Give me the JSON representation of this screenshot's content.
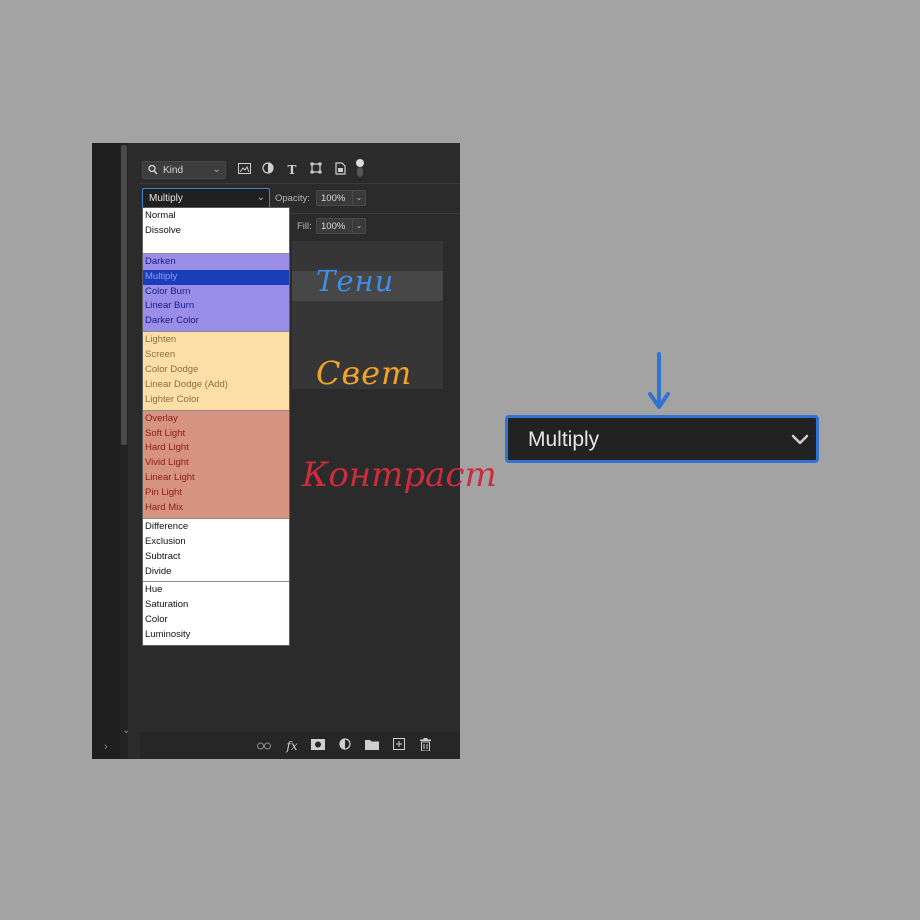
{
  "filter_bar": {
    "kind_label": "Kind",
    "icons": [
      "search-icon",
      "image-filter-icon",
      "adjustment-filter-icon",
      "type-filter-icon",
      "shape-filter-icon",
      "smart-object-filter-icon",
      "filter-toggle-icon"
    ]
  },
  "blend_mode": {
    "current": "Multiply",
    "opacity_label": "Opacity:",
    "opacity_value": "100%",
    "fill_label": "Fill:",
    "fill_value": "100%"
  },
  "dropdown_groups": [
    {
      "id": "basic",
      "items": [
        "Normal",
        "Dissolve"
      ]
    },
    {
      "id": "darken",
      "items": [
        "Darken",
        "Multiply",
        "Color Burn",
        "Linear Burn",
        "Darker Color"
      ],
      "selected": "Multiply"
    },
    {
      "id": "lighten",
      "items": [
        "Lighten",
        "Screen",
        "Color Dodge",
        "Linear Dodge (Add)",
        "Lighter Color"
      ]
    },
    {
      "id": "contrast",
      "items": [
        "Overlay",
        "Soft Light",
        "Hard Light",
        "Vivid Light",
        "Linear Light",
        "Pin Light",
        "Hard Mix"
      ]
    },
    {
      "id": "inversion",
      "items": [
        "Difference",
        "Exclusion",
        "Subtract",
        "Divide"
      ]
    },
    {
      "id": "component",
      "items": [
        "Hue",
        "Saturation",
        "Color",
        "Luminosity"
      ]
    }
  ],
  "annotations": {
    "shadows": "Тени",
    "light": "Свет",
    "contrast": "Контраст"
  },
  "bottom_bar": {
    "icons": [
      "link-layers-icon",
      "fx-icon",
      "layer-mask-icon",
      "adjustment-layer-icon",
      "group-folder-icon",
      "new-layer-icon",
      "trash-icon"
    ],
    "fx_label": "fx"
  },
  "zoom_callout": {
    "value": "Multiply"
  },
  "colors": {
    "shadow_group": "#9b8ee9",
    "light_group": "#fddea6",
    "contrast_group": "#d6937f",
    "selection": "#1a3db8",
    "accent_blue": "#2f74d0",
    "note_shadow": "#3c8fe6",
    "note_light": "#f0a328",
    "note_contrast": "#cc2d3d"
  }
}
